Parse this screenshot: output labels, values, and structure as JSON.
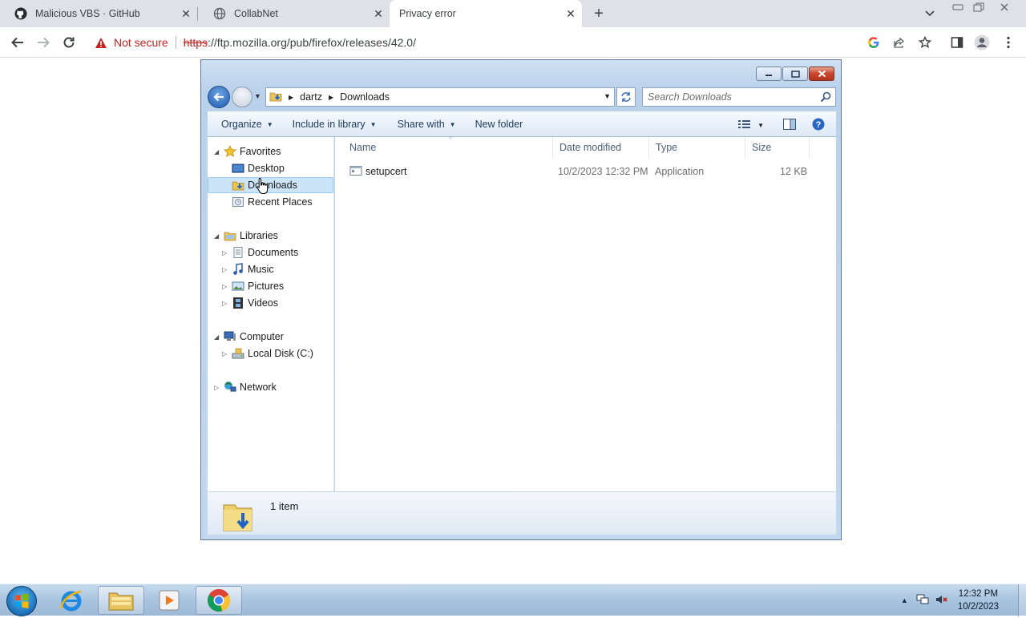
{
  "browser": {
    "tabs": [
      {
        "title": "Malicious VBS · GitHub",
        "icon": "github-icon"
      },
      {
        "title": "CollabNet",
        "icon": "globe-icon"
      },
      {
        "title": "Privacy error",
        "icon": "none",
        "active": true
      }
    ],
    "security_label": "Not secure",
    "url_scheme": "https",
    "url_rest": "://ftp.mozilla.org/pub/firefox/releases/42.0/"
  },
  "explorer": {
    "breadcrumb": [
      "dartz",
      "Downloads"
    ],
    "search_placeholder": "Search Downloads",
    "commands": [
      "Organize",
      "Include in library",
      "Share with",
      "New folder"
    ],
    "nav": {
      "favorites": "Favorites",
      "desktop": "Desktop",
      "downloads": "Downloads",
      "recent": "Recent Places",
      "libraries": "Libraries",
      "documents": "Documents",
      "music": "Music",
      "pictures": "Pictures",
      "videos": "Videos",
      "computer": "Computer",
      "local_disk": "Local Disk (C:)",
      "network": "Network"
    },
    "columns": [
      "Name",
      "Date modified",
      "Type",
      "Size"
    ],
    "files": [
      {
        "name": "setupcert",
        "date": "10/2/2023 12:32 PM",
        "type": "Application",
        "size": "12 KB"
      }
    ],
    "status_count": "1 item"
  },
  "taskbar": {
    "time": "12:32 PM",
    "date": "10/2/2023"
  }
}
